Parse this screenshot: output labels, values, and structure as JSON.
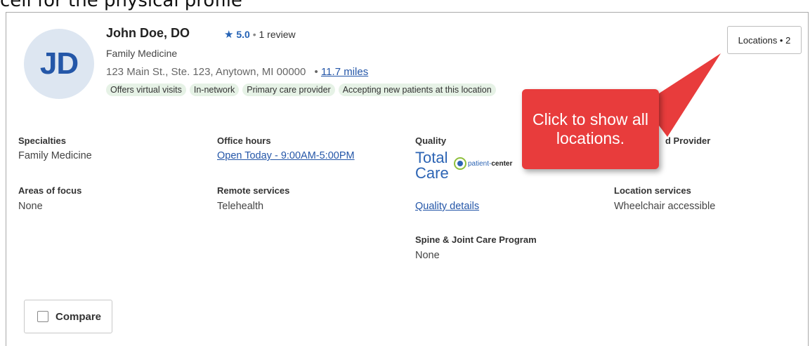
{
  "page_top_text": "cell for the physical profile",
  "provider": {
    "initials": "JD",
    "name": "John Doe, DO",
    "rating_score": "5.0",
    "rating_separator": "•",
    "review_count": "1 review",
    "specialty": "Family Medicine",
    "address": "123 Main St., Ste. 123, Anytown, MI 00000",
    "distance_separator": "•",
    "distance": "11.7 miles",
    "tags": [
      "Offers virtual visits",
      "In-network",
      "Primary care provider",
      "Accepting new patients at this location"
    ]
  },
  "locations_button": "Locations • 2",
  "details": {
    "specialties_label": "Specialties",
    "specialties_value": "Family Medicine",
    "areas_label": "Areas of focus",
    "areas_value": "None",
    "office_hours_label": "Office hours",
    "office_hours_value": "Open Today - 9:00AM-5:00PM",
    "remote_label": "Remote services",
    "remote_value": "Telehealth",
    "quality_label": "Quality",
    "quality_logo_line1": "Total",
    "quality_logo_line2": "Care",
    "pcmh_text_a": "patient-",
    "pcmh_text_b": "center",
    "quality_details_link": "Quality details",
    "spine_label": "Spine & Joint Care Program",
    "spine_value": "None",
    "provider_label_partial": "d Provider",
    "location_services_label": "Location services",
    "location_services_value": "Wheelchair accessible"
  },
  "compare_label": "Compare",
  "callout_text": "Click to show all locations.",
  "colors": {
    "accent_blue": "#2462b5",
    "tag_green": "#e6f2e6",
    "callout_red": "#e83c3c"
  }
}
